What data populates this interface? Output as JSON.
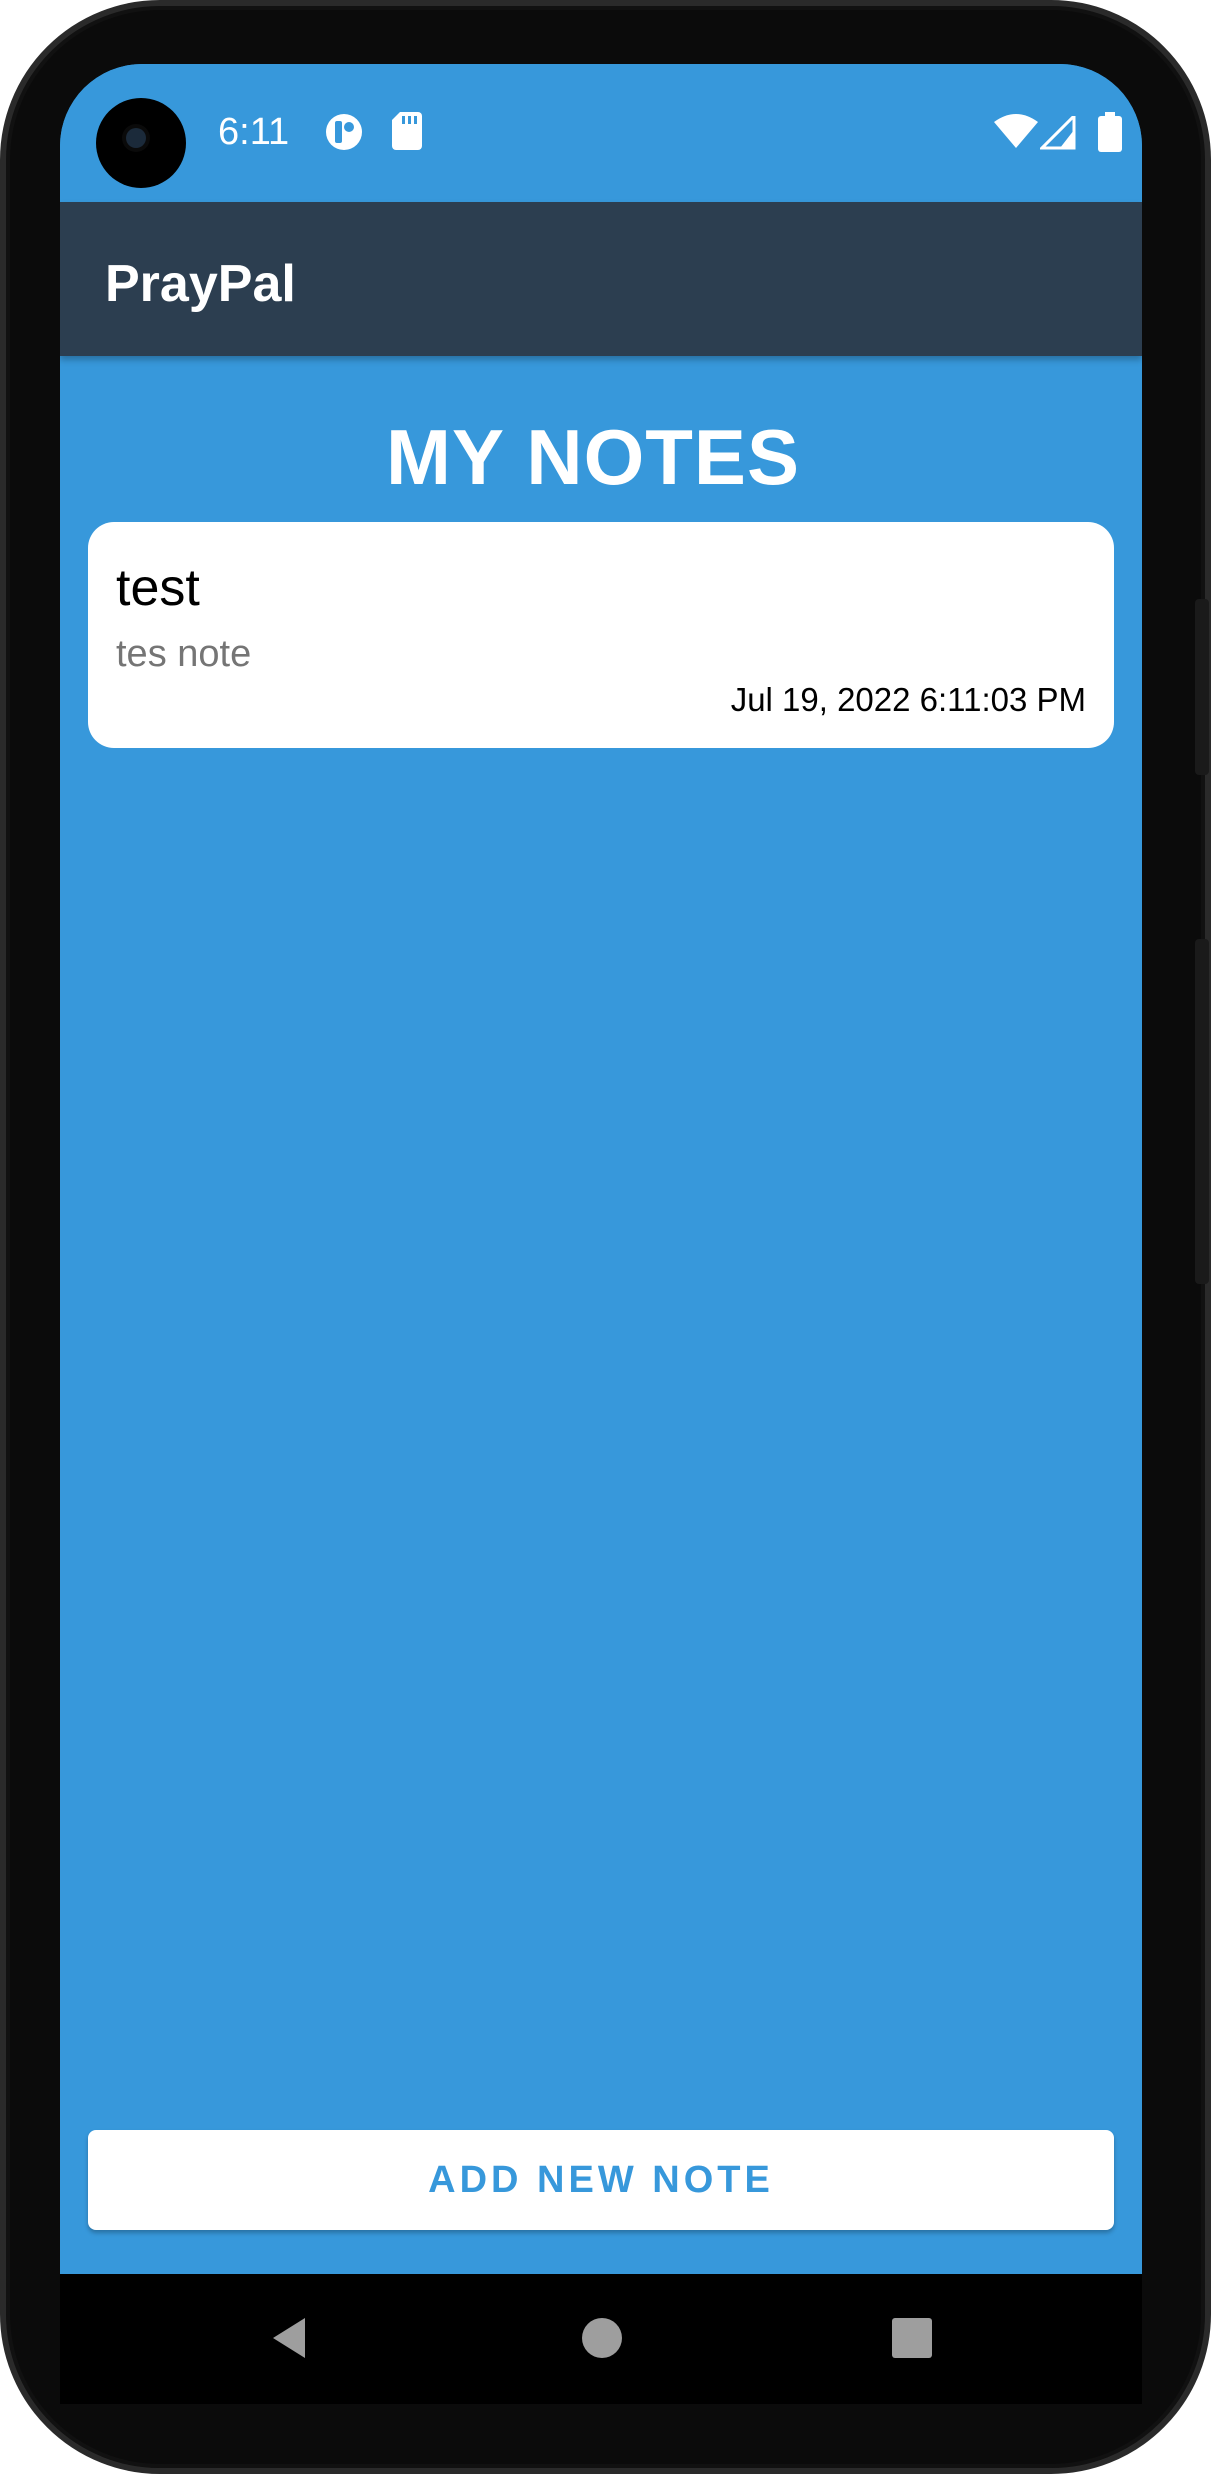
{
  "status_bar": {
    "time": "6:11",
    "icons": [
      "r-app-icon",
      "sd-card-icon",
      "wifi-icon",
      "cell-signal-icon",
      "battery-icon"
    ]
  },
  "app_bar": {
    "title": "PrayPal"
  },
  "main": {
    "page_title": "MY NOTES",
    "notes": [
      {
        "title": "test",
        "body": "tes note",
        "date": "Jul 19, 2022 6:11:03 PM"
      }
    ],
    "add_button_label": "ADD NEW NOTE"
  },
  "nav_bar": {
    "buttons": [
      "back-icon",
      "home-icon",
      "recents-icon"
    ]
  },
  "colors": {
    "background": "#3798db",
    "app_bar": "#2c3e50",
    "card": "#ffffff",
    "accent": "#3798db"
  }
}
